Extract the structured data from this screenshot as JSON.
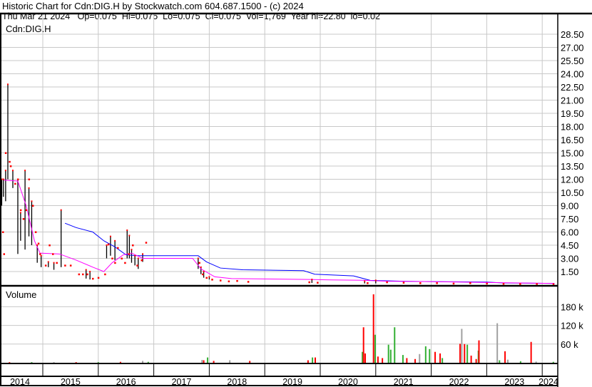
{
  "header": {
    "title": "Historic Chart for Cdn:DIG.H by Stockwatch.com 604.687.1500 - (c) 2024",
    "quote": "Thu Mar 21 2024   Op=0.075  Hi=0.075  Lo=0.075  Cl=0.075  Vol=1,769  Year hi=22.80  lo=0.02"
  },
  "chart_data": {
    "type": "bar",
    "symbol": "Cdn:DIG.H",
    "volume_label": "Volume",
    "years": [
      "2014",
      "2015",
      "2016",
      "2017",
      "2018",
      "2019",
      "2020",
      "2021",
      "2022",
      "2023",
      "2024"
    ],
    "price_ticks": [
      "1.50",
      "3.00",
      "4.50",
      "6.00",
      "7.50",
      "9.00",
      "10.50",
      "12.00",
      "13.50",
      "15.00",
      "16.50",
      "18.00",
      "19.50",
      "21.00",
      "22.50",
      "24.00",
      "25.50",
      "27.00",
      "28.50"
    ],
    "price_ylim": [
      0,
      30
    ],
    "volume_ticks": [
      "60 k",
      "120 k",
      "180 k"
    ],
    "volume_ylim_k": [
      0,
      240
    ],
    "colors": {
      "up": "#33b033",
      "down": "#ff0000",
      "flat": "#a0a0a0",
      "ma_long": "#0000ff",
      "ma_short": "#ff00ff",
      "bar": "#000000",
      "grid": "#c8c8c8"
    },
    "price_bars": [
      [
        2014.26,
        12,
        9
      ],
      [
        2014.29,
        12,
        10
      ],
      [
        2014.33,
        13,
        9.5
      ],
      [
        2014.37,
        22.8,
        12
      ],
      [
        2014.46,
        13,
        11
      ],
      [
        2014.55,
        12,
        3.5
      ],
      [
        2014.6,
        8.2,
        5
      ],
      [
        2014.68,
        13,
        4
      ],
      [
        2014.75,
        11,
        5.5
      ],
      [
        2014.8,
        9.5,
        4.5
      ],
      [
        2014.9,
        4.5,
        2.5
      ],
      [
        2014.97,
        3.3,
        2
      ],
      [
        2015.1,
        2.6,
        2
      ],
      [
        2015.2,
        2.5,
        1.7
      ],
      [
        2015.33,
        8.5,
        2
      ],
      [
        2015.78,
        1.7,
        0.7
      ],
      [
        2015.85,
        1.5,
        0.6
      ],
      [
        2016.15,
        4.5,
        3
      ],
      [
        2016.22,
        5.5,
        3.3
      ],
      [
        2016.3,
        5,
        2.8
      ],
      [
        2016.52,
        6.2,
        3
      ],
      [
        2016.56,
        5.6,
        3
      ],
      [
        2016.6,
        4,
        2.5
      ],
      [
        2016.66,
        3.3,
        2.2
      ],
      [
        2016.72,
        3,
        1.8
      ],
      [
        2016.8,
        3.5,
        2.6
      ],
      [
        2017.8,
        3,
        1.8
      ],
      [
        2017.85,
        2,
        1.2
      ],
      [
        2017.9,
        1.5,
        0.8
      ],
      [
        2018.0,
        0.9,
        0.6
      ],
      [
        2019.85,
        0.6,
        0.2
      ],
      [
        2020.8,
        0.4,
        0.15
      ],
      [
        2021.0,
        0.5,
        0.15
      ]
    ],
    "price_dots": [
      [
        2014.28,
        6
      ],
      [
        2014.3,
        3.5
      ],
      [
        2014.33,
        15
      ],
      [
        2014.4,
        14
      ],
      [
        2014.42,
        13.5
      ],
      [
        2014.5,
        11.5
      ],
      [
        2014.55,
        12
      ],
      [
        2014.6,
        8.5
      ],
      [
        2014.65,
        7.5
      ],
      [
        2014.7,
        8.5
      ],
      [
        2014.75,
        12
      ],
      [
        2014.82,
        9
      ],
      [
        2014.87,
        6
      ],
      [
        2014.92,
        4.7
      ],
      [
        2014.95,
        3.5
      ],
      [
        2015.05,
        2.2
      ],
      [
        2015.12,
        4.5
      ],
      [
        2015.18,
        3.5
      ],
      [
        2015.25,
        2.5
      ],
      [
        2015.4,
        2.2
      ],
      [
        2015.5,
        2.2
      ],
      [
        2015.65,
        1.2
      ],
      [
        2015.72,
        1.2
      ],
      [
        2015.8,
        1.2
      ],
      [
        2015.9,
        0.7
      ],
      [
        2016.0,
        0.8
      ],
      [
        2016.12,
        1.2
      ],
      [
        2016.18,
        4.6
      ],
      [
        2016.25,
        3
      ],
      [
        2016.3,
        2.5
      ],
      [
        2016.35,
        4.2
      ],
      [
        2016.42,
        3
      ],
      [
        2016.48,
        2.5
      ],
      [
        2016.55,
        3.5
      ],
      [
        2016.62,
        4.5
      ],
      [
        2016.7,
        2.2
      ],
      [
        2016.78,
        2.8
      ],
      [
        2016.86,
        4.8
      ],
      [
        2017.82,
        2.5
      ],
      [
        2017.88,
        1.2
      ],
      [
        2017.95,
        0.8
      ],
      [
        2018.05,
        0.6
      ],
      [
        2018.2,
        0.5
      ],
      [
        2018.35,
        0.4
      ],
      [
        2018.5,
        0.45
      ],
      [
        2018.7,
        0.35
      ],
      [
        2019.8,
        0.3
      ],
      [
        2019.95,
        0.25
      ],
      [
        2020.85,
        0.2
      ],
      [
        2021.2,
        0.3
      ],
      [
        2021.5,
        0.25
      ],
      [
        2021.8,
        0.2
      ],
      [
        2022.1,
        0.2
      ],
      [
        2022.4,
        0.15
      ],
      [
        2022.7,
        0.2
      ],
      [
        2023.0,
        0.15
      ],
      [
        2023.3,
        0.12
      ],
      [
        2023.6,
        0.1
      ],
      [
        2023.9,
        0.1
      ],
      [
        2024.2,
        0.075
      ]
    ],
    "ma_long": [
      [
        2015.4,
        7.0
      ],
      [
        2015.6,
        6.5
      ],
      [
        2015.9,
        6.0
      ],
      [
        2016.1,
        5.0
      ],
      [
        2016.3,
        4.3
      ],
      [
        2016.5,
        3.4
      ],
      [
        2016.7,
        3.3
      ],
      [
        2017.0,
        3.3
      ],
      [
        2017.8,
        3.3
      ],
      [
        2017.95,
        2.6
      ],
      [
        2018.2,
        1.9
      ],
      [
        2018.6,
        1.7
      ],
      [
        2019.7,
        1.6
      ],
      [
        2019.9,
        1.2
      ],
      [
        2020.6,
        1.0
      ],
      [
        2020.9,
        0.5
      ],
      [
        2021.5,
        0.4
      ],
      [
        2022.0,
        0.35
      ],
      [
        2023.0,
        0.3
      ],
      [
        2023.3,
        0.2
      ],
      [
        2024.22,
        0.15
      ]
    ],
    "ma_short": [
      [
        2014.3,
        11.9
      ],
      [
        2014.55,
        11.8
      ],
      [
        2014.7,
        9
      ],
      [
        2014.85,
        5
      ],
      [
        2014.95,
        3.6
      ],
      [
        2015.3,
        3.5
      ],
      [
        2015.6,
        2.8
      ],
      [
        2015.9,
        2.0
      ],
      [
        2016.1,
        1.5
      ],
      [
        2016.25,
        2.5
      ],
      [
        2016.45,
        3.4
      ],
      [
        2016.6,
        3.6
      ],
      [
        2016.8,
        3.0
      ],
      [
        2017.7,
        3.0
      ],
      [
        2017.85,
        1.8
      ],
      [
        2018.1,
        0.9
      ],
      [
        2018.4,
        0.7
      ],
      [
        2019.8,
        0.6
      ],
      [
        2020.2,
        0.55
      ],
      [
        2020.8,
        0.5
      ],
      [
        2021.2,
        0.4
      ],
      [
        2022.0,
        0.35
      ],
      [
        2023.0,
        0.25
      ],
      [
        2024.22,
        0.15
      ]
    ],
    "volume_k": [
      [
        2014.4,
        2,
        "down"
      ],
      [
        2014.8,
        2,
        "up"
      ],
      [
        2015.2,
        2,
        "flat"
      ],
      [
        2015.6,
        2,
        "down"
      ],
      [
        2016.0,
        2,
        "up"
      ],
      [
        2016.4,
        3,
        "down"
      ],
      [
        2016.8,
        6,
        "flat"
      ],
      [
        2016.9,
        3,
        "up"
      ],
      [
        2017.87,
        9,
        "flat"
      ],
      [
        2017.9,
        8,
        "down"
      ],
      [
        2017.97,
        17,
        "up"
      ],
      [
        2018.08,
        6,
        "down"
      ],
      [
        2018.37,
        8,
        "flat"
      ],
      [
        2018.73,
        6,
        "down"
      ],
      [
        2019.78,
        8,
        "down"
      ],
      [
        2019.86,
        17,
        "up"
      ],
      [
        2019.91,
        17,
        "down"
      ],
      [
        2020.76,
        35,
        "up"
      ],
      [
        2020.78,
        114,
        "down"
      ],
      [
        2020.81,
        30,
        "down"
      ],
      [
        2020.96,
        220,
        "down"
      ],
      [
        2020.99,
        90,
        "up"
      ],
      [
        2021.04,
        20,
        "down"
      ],
      [
        2021.12,
        15,
        "down"
      ],
      [
        2021.23,
        58,
        "up"
      ],
      [
        2021.27,
        42,
        "up"
      ],
      [
        2021.34,
        114,
        "up"
      ],
      [
        2021.49,
        25,
        "up"
      ],
      [
        2021.56,
        15,
        "down"
      ],
      [
        2021.71,
        12,
        "down"
      ],
      [
        2021.79,
        28,
        "flat"
      ],
      [
        2021.9,
        53,
        "up"
      ],
      [
        2021.97,
        44,
        "up"
      ],
      [
        2022.07,
        35,
        "down"
      ],
      [
        2022.16,
        30,
        "down"
      ],
      [
        2022.2,
        15,
        "up"
      ],
      [
        2022.52,
        61,
        "down"
      ],
      [
        2022.55,
        109,
        "flat"
      ],
      [
        2022.6,
        60,
        "down"
      ],
      [
        2022.65,
        58,
        "up"
      ],
      [
        2022.72,
        23,
        "down"
      ],
      [
        2022.81,
        12,
        "down"
      ],
      [
        2022.85,
        39,
        "up"
      ],
      [
        2022.86,
        72,
        "down"
      ],
      [
        2023.19,
        127,
        "flat"
      ],
      [
        2023.23,
        8,
        "up"
      ],
      [
        2023.33,
        37,
        "down"
      ],
      [
        2023.38,
        10,
        "flat"
      ],
      [
        2023.61,
        5,
        "up"
      ],
      [
        2023.8,
        67,
        "down"
      ],
      [
        2023.89,
        4,
        "flat"
      ],
      [
        2024.2,
        3,
        "up"
      ]
    ]
  }
}
